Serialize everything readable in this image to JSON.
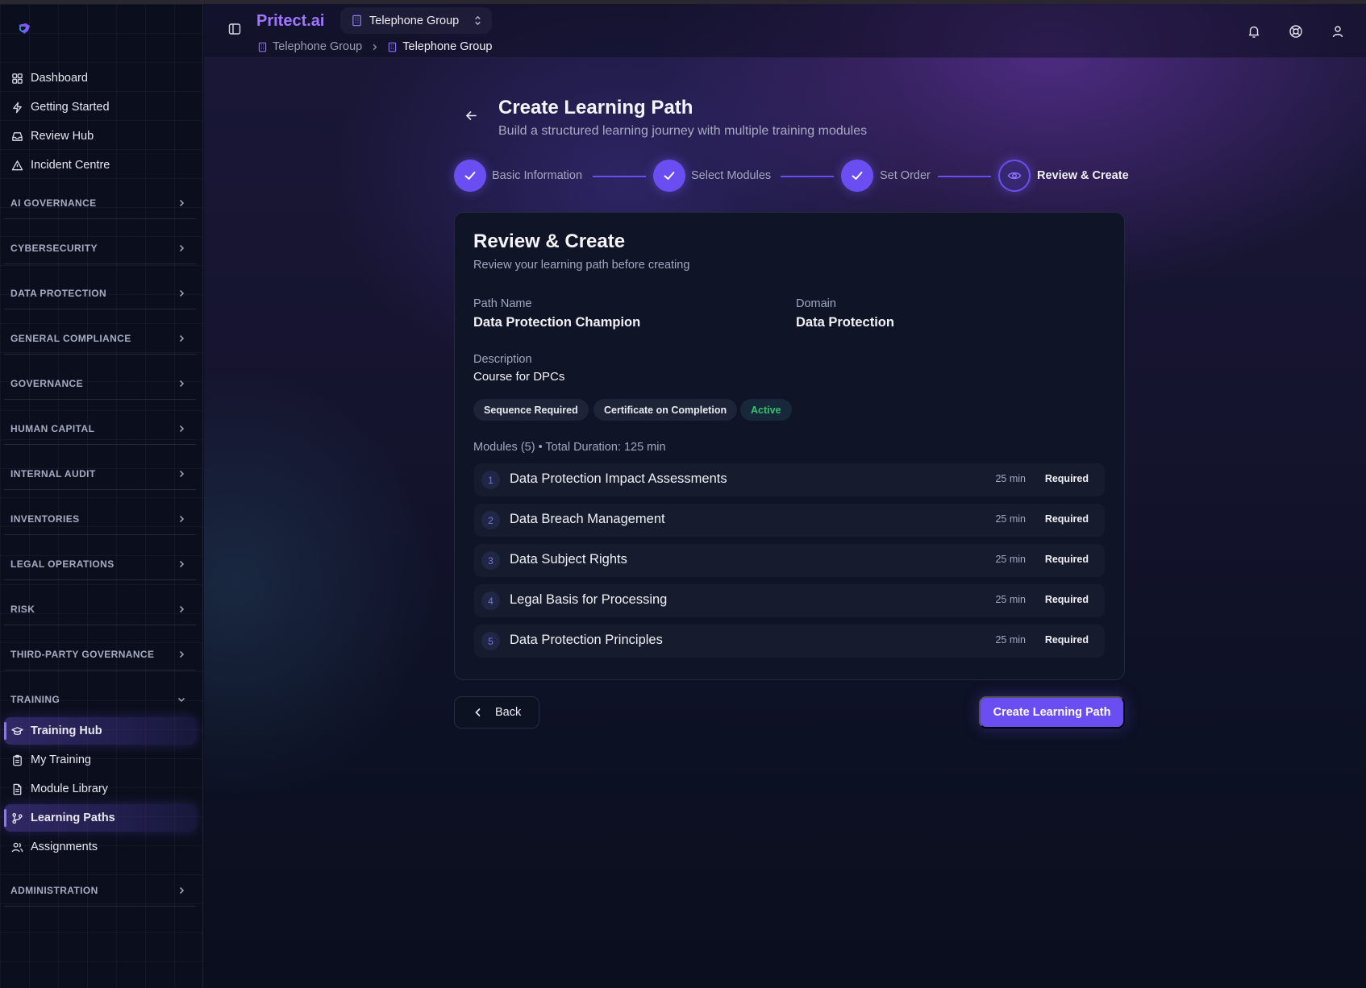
{
  "app": {
    "brand": "Pritect.ai",
    "org": "Telephone Group"
  },
  "breadcrumb": {
    "first": "Telephone Group",
    "current": "Telephone Group"
  },
  "sidebar": {
    "top_items": [
      {
        "label": "Dashboard",
        "icon": "grid-icon"
      },
      {
        "label": "Getting Started",
        "icon": "bolt-icon"
      },
      {
        "label": "Review Hub",
        "icon": "inbox-icon"
      },
      {
        "label": "Incident Centre",
        "icon": "warning-icon"
      }
    ],
    "sections": [
      "AI GOVERNANCE",
      "CYBERSECURITY",
      "DATA PROTECTION",
      "GENERAL COMPLIANCE",
      "GOVERNANCE",
      "HUMAN CAPITAL",
      "INTERNAL AUDIT",
      "INVENTORIES",
      "LEGAL OPERATIONS",
      "RISK",
      "THIRD-PARTY GOVERNANCE",
      "TRAINING"
    ],
    "training_items": [
      {
        "label": "Training Hub",
        "icon": "graduation-cap-icon"
      },
      {
        "label": "My Training",
        "icon": "clipboard-icon"
      },
      {
        "label": "Module Library",
        "icon": "document-icon"
      },
      {
        "label": "Learning Paths",
        "icon": "git-branch-icon"
      },
      {
        "label": "Assignments",
        "icon": "users-icon"
      }
    ],
    "admin_section": "ADMINISTRATION"
  },
  "page": {
    "title": "Create Learning Path",
    "subtitle": "Build a structured learning journey with multiple training modules"
  },
  "stepper": [
    {
      "label": "Basic Information",
      "state": "done"
    },
    {
      "label": "Select Modules",
      "state": "done"
    },
    {
      "label": "Set Order",
      "state": "done"
    },
    {
      "label": "Review & Create",
      "state": "current"
    }
  ],
  "review": {
    "title": "Review & Create",
    "subtitle": "Review your learning path before creating",
    "path_name_label": "Path Name",
    "path_name": "Data Protection Champion",
    "domain_label": "Domain",
    "domain": "Data Protection",
    "description_label": "Description",
    "description": "Course for DPCs",
    "badges": [
      "Sequence Required",
      "Certificate on Completion",
      "Active"
    ],
    "modules_summary": "Modules (5) • Total Duration: 125 min",
    "modules": [
      {
        "num": "1",
        "name": "Data Protection Impact Assessments",
        "duration": "25 min",
        "status": "Required"
      },
      {
        "num": "2",
        "name": "Data Breach Management",
        "duration": "25 min",
        "status": "Required"
      },
      {
        "num": "3",
        "name": "Data Subject Rights",
        "duration": "25 min",
        "status": "Required"
      },
      {
        "num": "4",
        "name": "Legal Basis for Processing",
        "duration": "25 min",
        "status": "Required"
      },
      {
        "num": "5",
        "name": "Data Protection Principles",
        "duration": "25 min",
        "status": "Required"
      }
    ]
  },
  "actions": {
    "back": "Back",
    "create": "Create Learning Path"
  },
  "colors": {
    "accent": "#6b4ef2",
    "brand": "#9f77ff",
    "active_badge": "#34c26e"
  }
}
